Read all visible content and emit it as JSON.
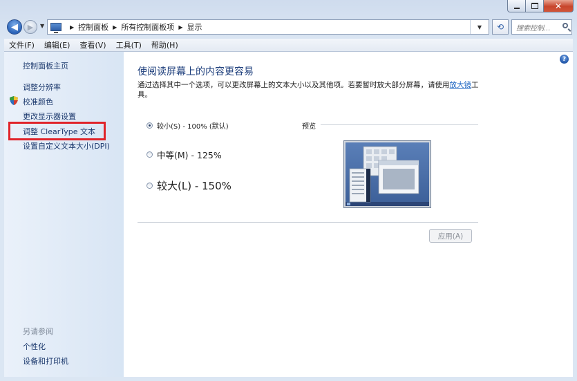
{
  "window": {
    "caption_buttons": {
      "close_glyph": "✕"
    }
  },
  "navbar": {
    "back_glyph": "◀",
    "forward_glyph": "▶",
    "breadcrumb": [
      "控制面板",
      "所有控制面板项",
      "显示"
    ],
    "search_placeholder": "搜索控制..."
  },
  "menu": [
    "文件(F)",
    "编辑(E)",
    "查看(V)",
    "工具(T)",
    "帮助(H)"
  ],
  "sidebar": {
    "home": "控制面板主页",
    "links": [
      "调整分辨率",
      "校准颜色",
      "更改显示器设置",
      "调整 ClearType 文本",
      "设置自定义文本大小(DPI)"
    ],
    "see_also_title": "另请参阅",
    "see_also": [
      "个性化",
      "设备和打印机"
    ],
    "highlight_color": "#e0242a"
  },
  "main": {
    "title": "使阅读屏幕上的内容更容易",
    "description_before": "通过选择其中一个选项，可以更改屏幕上的文本大小以及其他项。若要暂时放大部分屏幕，请使用",
    "description_link": "放大镜",
    "description_after": "工具。",
    "options": [
      {
        "label": "较小(S) - 100% (默认)",
        "checked": true
      },
      {
        "label": "中等(M) - 125%",
        "checked": false
      },
      {
        "label": "较大(L) - 150%",
        "checked": false
      }
    ],
    "preview_label": "预览",
    "apply_label": "应用(A)",
    "help_glyph": "?"
  }
}
